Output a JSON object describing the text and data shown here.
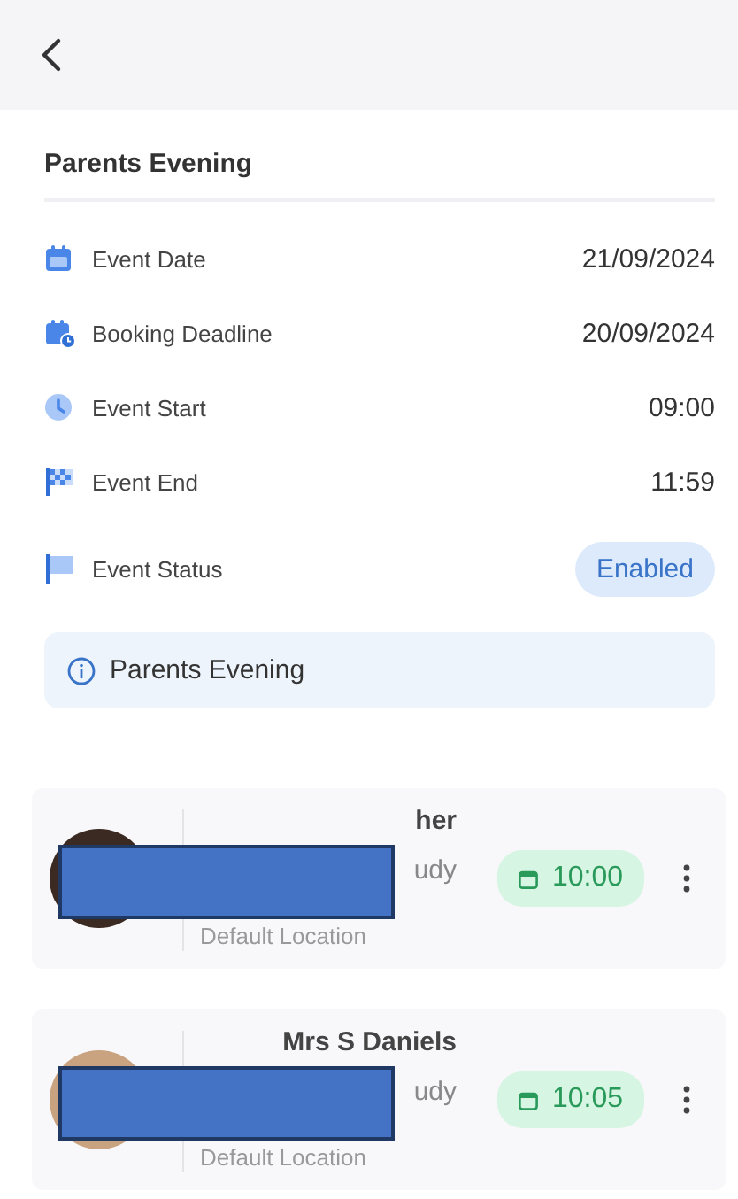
{
  "event": {
    "title": "Parents Evening",
    "details": [
      {
        "kind": "date",
        "label": "Event Date",
        "value": "21/09/2024"
      },
      {
        "kind": "deadline",
        "label": "Booking Deadline",
        "value": "20/09/2024"
      },
      {
        "kind": "start",
        "label": "Event Start",
        "value": "09:00"
      },
      {
        "kind": "end",
        "label": "Event End",
        "value": "11:59"
      },
      {
        "kind": "status",
        "label": "Event Status",
        "value": "Enabled"
      }
    ],
    "note": "Parents Evening"
  },
  "appointments": [
    {
      "name": "her",
      "subject": "udy",
      "location": "Default Location",
      "time": "10:00",
      "redacted": true
    },
    {
      "name": "Mrs S Daniels",
      "subject": "udy",
      "location": "Default Location",
      "time": "10:05",
      "redacted": true
    }
  ]
}
